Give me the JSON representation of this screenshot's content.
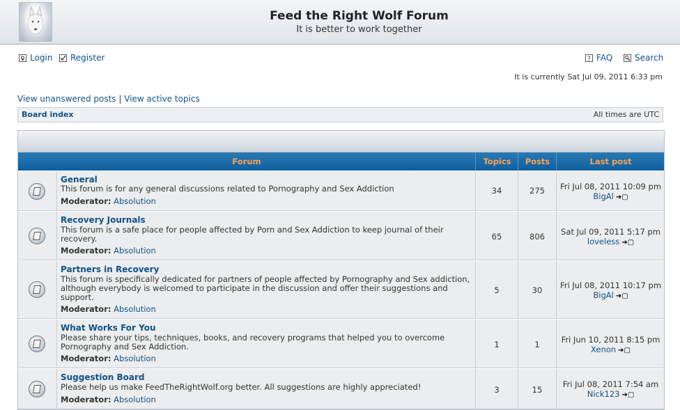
{
  "header": {
    "title": "Feed the Right Wolf Forum",
    "subtitle": "It is better to work together"
  },
  "toplinks": {
    "login": "Login",
    "register": "Register",
    "faq": "FAQ",
    "search": "Search"
  },
  "current_time": "It is currently Sat Jul 09, 2011 6:33 pm",
  "viewlinks": {
    "unanswered": "View unanswered posts",
    "separator": "|",
    "active": "View active topics"
  },
  "navbar": {
    "board_index": "Board index",
    "timezone": "All times are UTC"
  },
  "table": {
    "col_forum": "Forum",
    "col_topics": "Topics",
    "col_posts": "Posts",
    "col_last": "Last post",
    "moderator_label": "Moderator:",
    "forums": [
      {
        "title": "General",
        "desc": "This forum is for any general discussions related to Pornography and Sex Addiction",
        "moderator": "Absolution",
        "topics": "34",
        "posts": "275",
        "last_date": "Fri Jul 08, 2011 10:09 pm",
        "last_user": "BigAl"
      },
      {
        "title": "Recovery Journals",
        "desc": "This forum is a safe place for people affected by Porn and Sex Addiction to keep journal of their recovery.",
        "moderator": "Absolution",
        "topics": "65",
        "posts": "806",
        "last_date": "Sat Jul 09, 2011 5:17 pm",
        "last_user": "loveless"
      },
      {
        "title": "Partners in Recovery",
        "desc": "This forum is specifically dedicated for partners of people affected by Pornography and Sex addiction, although everybody is welcomed to participate in the discussion and offer their suggestions and support.",
        "moderator": "Absolution",
        "topics": "5",
        "posts": "30",
        "last_date": "Fri Jul 08, 2011 10:17 pm",
        "last_user": "BigAl"
      },
      {
        "title": "What Works For You",
        "desc": "Please share your tips, techniques, books, and recovery programs that helped you to overcome Pornography and Sex Addiction.",
        "moderator": "Absolution",
        "topics": "1",
        "posts": "1",
        "last_date": "Fri Jun 10, 2011 8:15 pm",
        "last_user": "Xenon"
      },
      {
        "title": "Suggestion Board",
        "desc": "Please help us make FeedTheRightWolf.org better. All suggestions are highly appreciated!",
        "moderator": "Absolution",
        "topics": "3",
        "posts": "15",
        "last_date": "Fri Jul 08, 2011 7:54 am",
        "last_user": "Nick123"
      }
    ]
  }
}
